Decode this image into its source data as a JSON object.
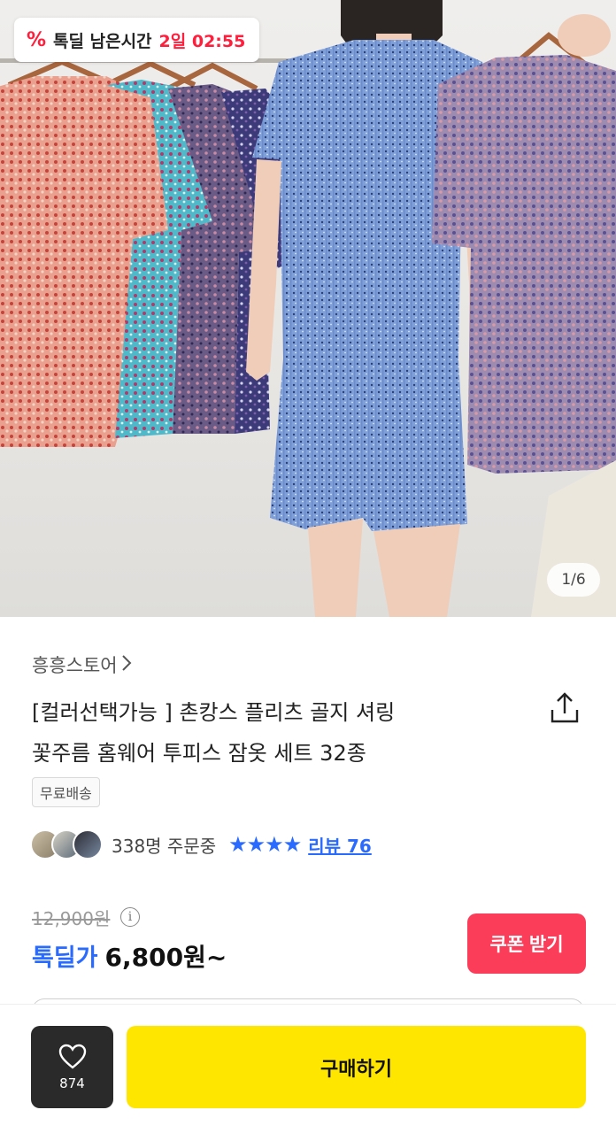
{
  "deal_timer": {
    "icon": "percent-icon",
    "label": "톡딜 남은시간",
    "time": "2일 02:55"
  },
  "gallery": {
    "indicator": "1/6"
  },
  "product": {
    "store": "흥흥스토어",
    "title_line1": "[컬러선택가능 ] 촌캉스 플리츠 골지 셔링",
    "title_line2": "꽃주름 홈웨어 투피스 잠옷 세트 32종",
    "tag_shipping": "무료배송",
    "orders": "338명 주문중",
    "stars": "★★★★",
    "reviews": "리뷰 76",
    "original_price": "12,900원",
    "deal_label": "톡딜가",
    "deal_price": "6,800원~",
    "coupon_button": "쿠폰 받기"
  },
  "bottom_bar": {
    "like_count": "874",
    "buy_button": "구매하기"
  },
  "colors": {
    "accent_blue": "#2a6bff",
    "deal_red": "#ff1e3c",
    "coupon_pink": "#fb3d59",
    "buy_yellow": "#ffe600"
  }
}
